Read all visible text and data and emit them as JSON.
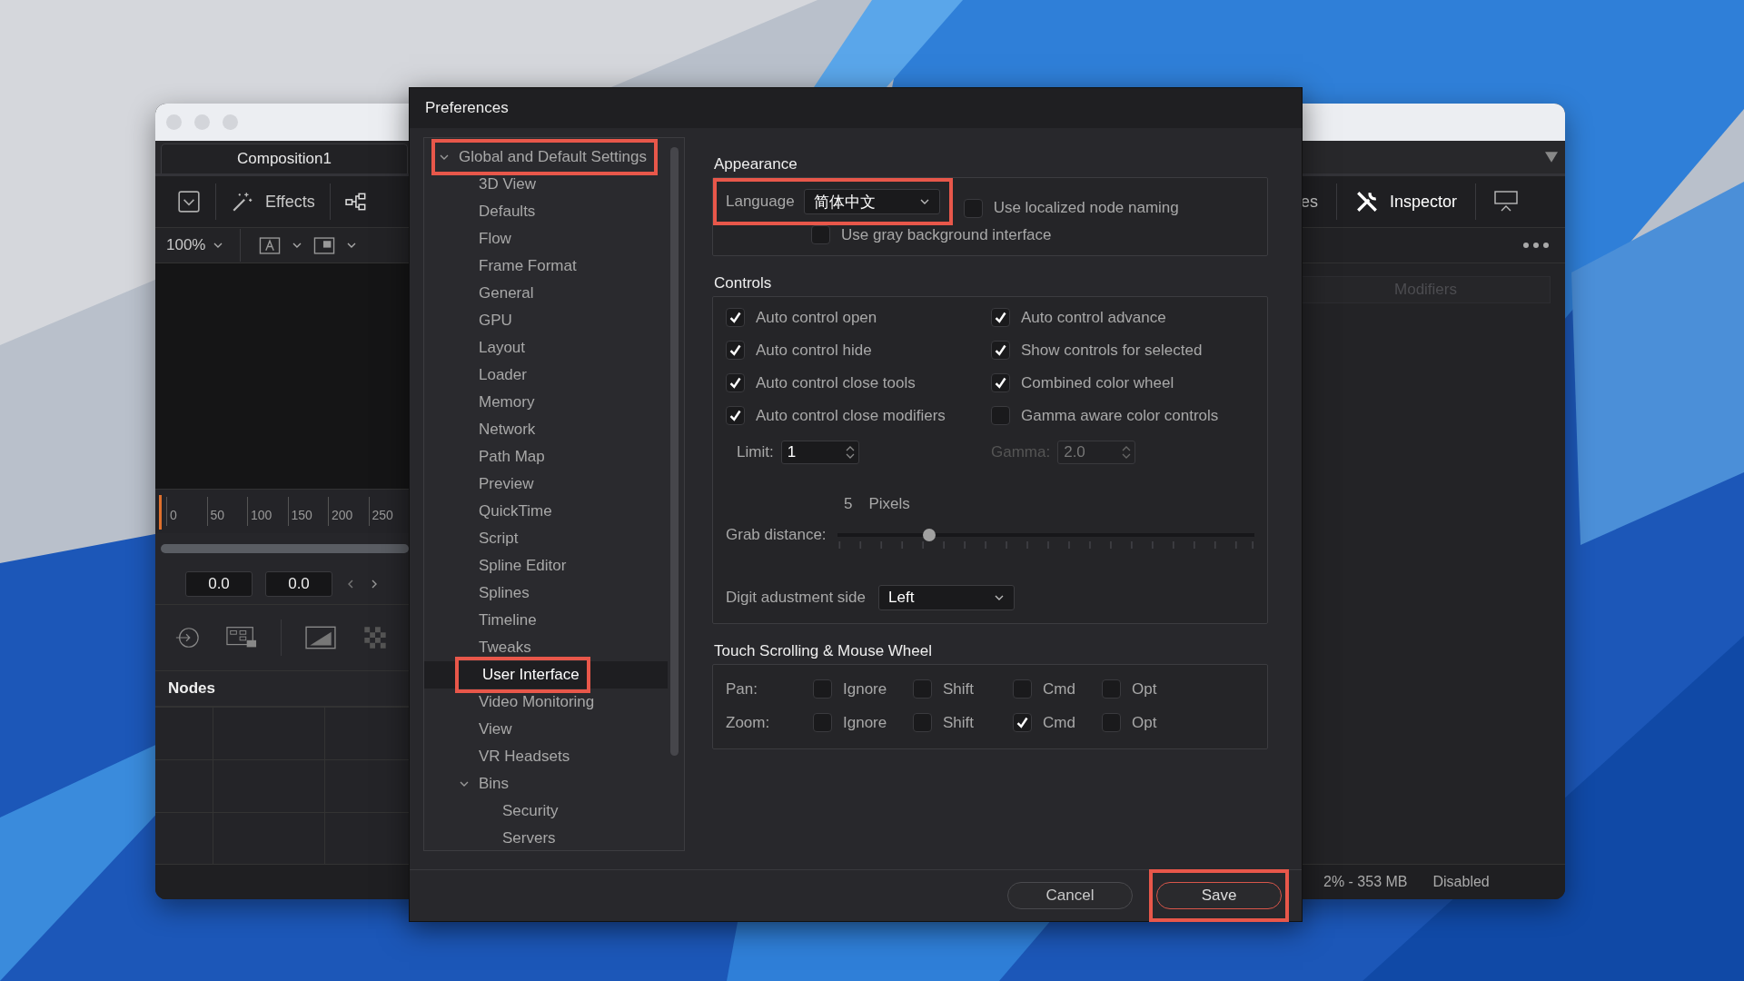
{
  "app_window": {
    "tab": "Composition1",
    "effects": "Effects",
    "zoom": "100%",
    "ruler_ticks": [
      "0",
      "50",
      "100",
      "150",
      "200",
      "250"
    ],
    "time_fields": [
      "0.0",
      "0.0"
    ],
    "nodes_title": "Nodes",
    "right_cut_label": "es",
    "inspector": "Inspector",
    "modifiers": "Modifiers",
    "memory": "2% -  353 MB",
    "status": "Disabled"
  },
  "dialog": {
    "title": "Preferences",
    "tree": [
      {
        "label": "Global and Default Settings",
        "expanded": true,
        "selected": false,
        "highlighted": true,
        "children": [
          {
            "label": "3D View",
            "selected": false
          },
          {
            "label": "Defaults",
            "selected": false
          },
          {
            "label": "Flow",
            "selected": false
          },
          {
            "label": "Frame Format",
            "selected": false
          },
          {
            "label": "General",
            "selected": false
          },
          {
            "label": "GPU",
            "selected": false
          },
          {
            "label": "Layout",
            "selected": false
          },
          {
            "label": "Loader",
            "selected": false
          },
          {
            "label": "Memory",
            "selected": false
          },
          {
            "label": "Network",
            "selected": false
          },
          {
            "label": "Path Map",
            "selected": false
          },
          {
            "label": "Preview",
            "selected": false
          },
          {
            "label": "QuickTime",
            "selected": false
          },
          {
            "label": "Script",
            "selected": false
          },
          {
            "label": "Spline Editor",
            "selected": false
          },
          {
            "label": "Splines",
            "selected": false
          },
          {
            "label": "Timeline",
            "selected": false
          },
          {
            "label": "Tweaks",
            "selected": false
          },
          {
            "label": "User Interface",
            "selected": true,
            "highlighted": true
          },
          {
            "label": "Video Monitoring",
            "selected": false
          },
          {
            "label": "View",
            "selected": false
          },
          {
            "label": "VR Headsets",
            "selected": false
          },
          {
            "label": "Bins",
            "expanded": true,
            "selected": false,
            "children": [
              {
                "label": "Security",
                "selected": false
              },
              {
                "label": "Servers",
                "selected": false
              }
            ]
          }
        ]
      }
    ],
    "appearance": {
      "title": "Appearance",
      "language_label": "Language",
      "language": "简体中文",
      "language_highlighted": true,
      "localized_naming": {
        "label": "Use localized node naming",
        "checked": false
      },
      "gray_background": {
        "label": "Use gray background interface",
        "checked": false
      }
    },
    "controls": {
      "title": "Controls",
      "checks": [
        {
          "label": "Auto control open",
          "checked": true
        },
        {
          "label": "Auto control advance",
          "checked": true
        },
        {
          "label": "Auto control hide",
          "checked": true
        },
        {
          "label": "Show controls for selected",
          "checked": true
        },
        {
          "label": "Auto control close tools",
          "checked": true
        },
        {
          "label": "Combined color wheel",
          "checked": true
        },
        {
          "label": "Auto control close modifiers",
          "checked": true
        },
        {
          "label": "Gamma aware color controls",
          "checked": false
        }
      ],
      "limit": {
        "label": "Limit:",
        "value": "1",
        "disabled": false
      },
      "gamma": {
        "label": "Gamma:",
        "value": "2.0",
        "disabled": true
      },
      "grab": {
        "value": "5",
        "unit": "Pixels",
        "label": "Grab distance:",
        "level": 0.22
      },
      "digit": {
        "label": "Digit adustment side",
        "value": "Left"
      }
    },
    "touch": {
      "title": "Touch Scrolling & Mouse Wheel",
      "rows": [
        {
          "label": "Pan:",
          "options": [
            {
              "label": "Ignore",
              "checked": false
            },
            {
              "label": "Shift",
              "checked": false
            },
            {
              "label": "Cmd",
              "checked": false
            },
            {
              "label": "Opt",
              "checked": false
            }
          ]
        },
        {
          "label": "Zoom:",
          "options": [
            {
              "label": "Ignore",
              "checked": false
            },
            {
              "label": "Shift",
              "checked": false
            },
            {
              "label": "Cmd",
              "checked": true
            },
            {
              "label": "Opt",
              "checked": false
            }
          ]
        }
      ]
    },
    "buttons": [
      {
        "label": "Cancel",
        "primary": false,
        "highlighted": false
      },
      {
        "label": "Save",
        "primary": true,
        "highlighted": true
      }
    ]
  }
}
